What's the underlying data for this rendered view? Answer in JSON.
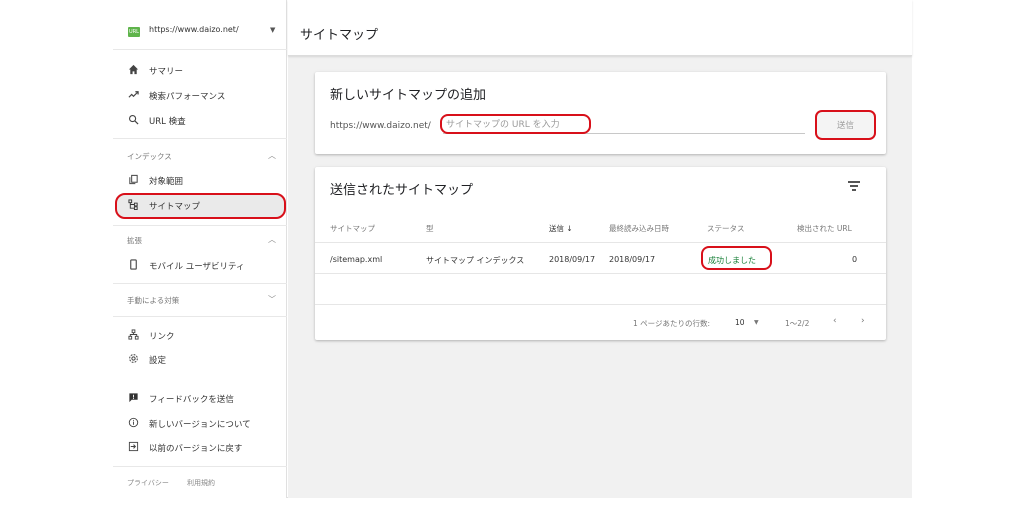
{
  "property": {
    "badge_text": "URL",
    "url": "https://www.daizo.net/",
    "dropdown_icon": "caret-down-icon"
  },
  "nav": {
    "summary": {
      "label": "サマリー",
      "icon": "home-icon"
    },
    "performance": {
      "label": "検索パフォーマンス",
      "icon": "trending-icon"
    },
    "url_inspection": {
      "label": "URL 検査",
      "icon": "search-icon"
    },
    "index_section": "インデックス",
    "coverage": {
      "label": "対象範囲",
      "icon": "copy-icon"
    },
    "sitemaps": {
      "label": "サイトマップ",
      "icon": "sitemap-icon"
    },
    "enhancements_section": "拡張",
    "mobile_usability": {
      "label": "モバイル ユーザビリティ",
      "icon": "phone-icon"
    },
    "manual_actions_section": "手動による対策",
    "links": {
      "label": "リンク",
      "icon": "network-icon"
    },
    "settings": {
      "label": "設定",
      "icon": "gear-icon"
    },
    "feedback": {
      "label": "フィードバックを送信",
      "icon": "feedback-icon"
    },
    "new_version": {
      "label": "新しいバージョンについて",
      "icon": "info-icon"
    },
    "old_version": {
      "label": "以前のバージョンに戻す",
      "icon": "exit-icon"
    }
  },
  "footer": {
    "privacy": "プライバシー",
    "terms": "利用規約"
  },
  "header": {
    "title": "サイトマップ"
  },
  "add_card": {
    "title": "新しいサイトマップの追加",
    "prefix": "https://www.daizo.net/",
    "input_placeholder": "サイトマップの URL を入力",
    "input_value": "",
    "submit_label": "送信"
  },
  "submitted_card": {
    "title": "送信されたサイトマップ",
    "filter_icon": "filter-icon",
    "columns": {
      "sitemap": "サイトマップ",
      "type": "型",
      "submitted": "送信 ↓",
      "last_read": "最終読み込み日時",
      "status": "ステータス",
      "detected_urls": "検出された URL"
    },
    "rows": [
      {
        "sitemap": "/sitemap.xml",
        "type": "サイトマップ インデックス",
        "submitted": "2018/09/17",
        "last_read": "2018/09/17",
        "status": "成功しました",
        "detected_urls": "0"
      }
    ],
    "pager": {
      "rows_per_page_label": "1 ページあたりの行数:",
      "rows_per_page": "10",
      "range": "1〜2/2",
      "prev_icon": "chevron-left-icon",
      "next_icon": "chevron-right-icon"
    }
  },
  "colors": {
    "accent_green": "#5fb44b",
    "status_success": "#188038",
    "annotation_red": "#d8101a"
  }
}
